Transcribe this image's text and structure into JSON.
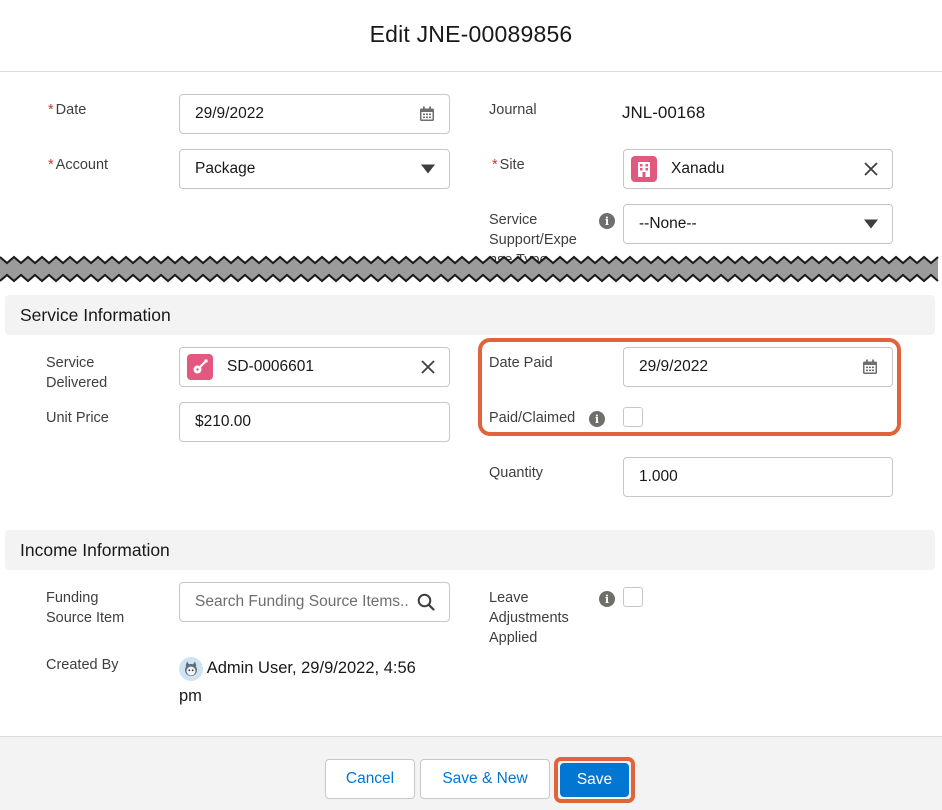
{
  "modal": {
    "title": "Edit JNE-00089856"
  },
  "top": {
    "date": {
      "label": "Date",
      "value": "29/9/2022"
    },
    "account": {
      "label": "Account",
      "value": "Package"
    },
    "journal": {
      "label": "Journal",
      "value": "JNL-00168"
    },
    "site": {
      "label": "Site",
      "value": "Xanadu"
    },
    "service_support": {
      "label_line1": "Service",
      "label_line2": "Support/Expe",
      "label_line3": "nse Type",
      "value": "--None--"
    }
  },
  "service_info": {
    "title": "Service Information",
    "service_delivered": {
      "label_line1": "Service",
      "label_line2": "Delivered",
      "value": "SD-0006601"
    },
    "unit_price": {
      "label": "Unit Price",
      "value": "$210.00"
    },
    "date_paid": {
      "label": "Date Paid",
      "value": "29/9/2022"
    },
    "paid_claimed": {
      "label": "Paid/Claimed"
    },
    "quantity": {
      "label": "Quantity",
      "value": "1.000"
    }
  },
  "income_info": {
    "title": "Income Information",
    "funding_source": {
      "label_line1": "Funding",
      "label_line2": "Source Item",
      "placeholder": "Search Funding Source Items..."
    },
    "leave_adjustments": {
      "label_line1": "Leave",
      "label_line2": "Adjustments",
      "label_line3": "Applied"
    },
    "created_by": {
      "label": "Created By",
      "value_line1": "Admin User, 29/9/2022, 4:56",
      "value_line2": "pm"
    }
  },
  "footer": {
    "cancel": "Cancel",
    "save_new": "Save & New",
    "save": "Save"
  },
  "colors": {
    "brand": "#0176d3",
    "highlight": "#e0633b",
    "badge": "#e3587e",
    "required": "#c23934"
  },
  "icons": {
    "calendar": "calendar-icon",
    "dropdown": "chevron-down-icon",
    "clear": "close-icon",
    "search": "search-icon",
    "info": "info-icon"
  }
}
